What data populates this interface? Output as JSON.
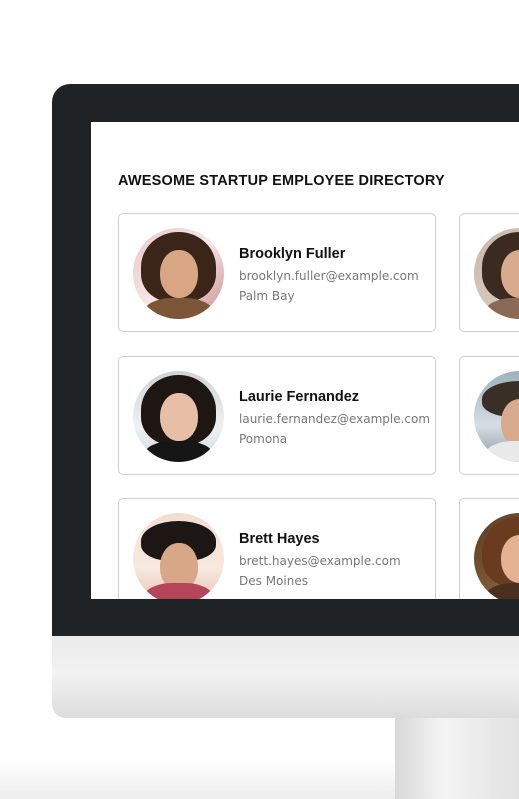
{
  "directory": {
    "title": "AWESOME STARTUP EMPLOYEE DIRECTORY",
    "employees": [
      {
        "name": "Brooklyn Fuller",
        "email": "brooklyn.fuller@example.com",
        "city": "Palm Bay"
      },
      {
        "name": "Laurie Fernandez",
        "email": "laurie.fernandez@example.com",
        "city": "Pomona"
      },
      {
        "name": "Brett Hayes",
        "email": "brett.hayes@example.com",
        "city": "Des Moines"
      }
    ]
  },
  "colors": {
    "bezel": "#1f2326",
    "card_border": "#cfcfcf",
    "name_text": "#111111",
    "detail_text": "#777777"
  }
}
